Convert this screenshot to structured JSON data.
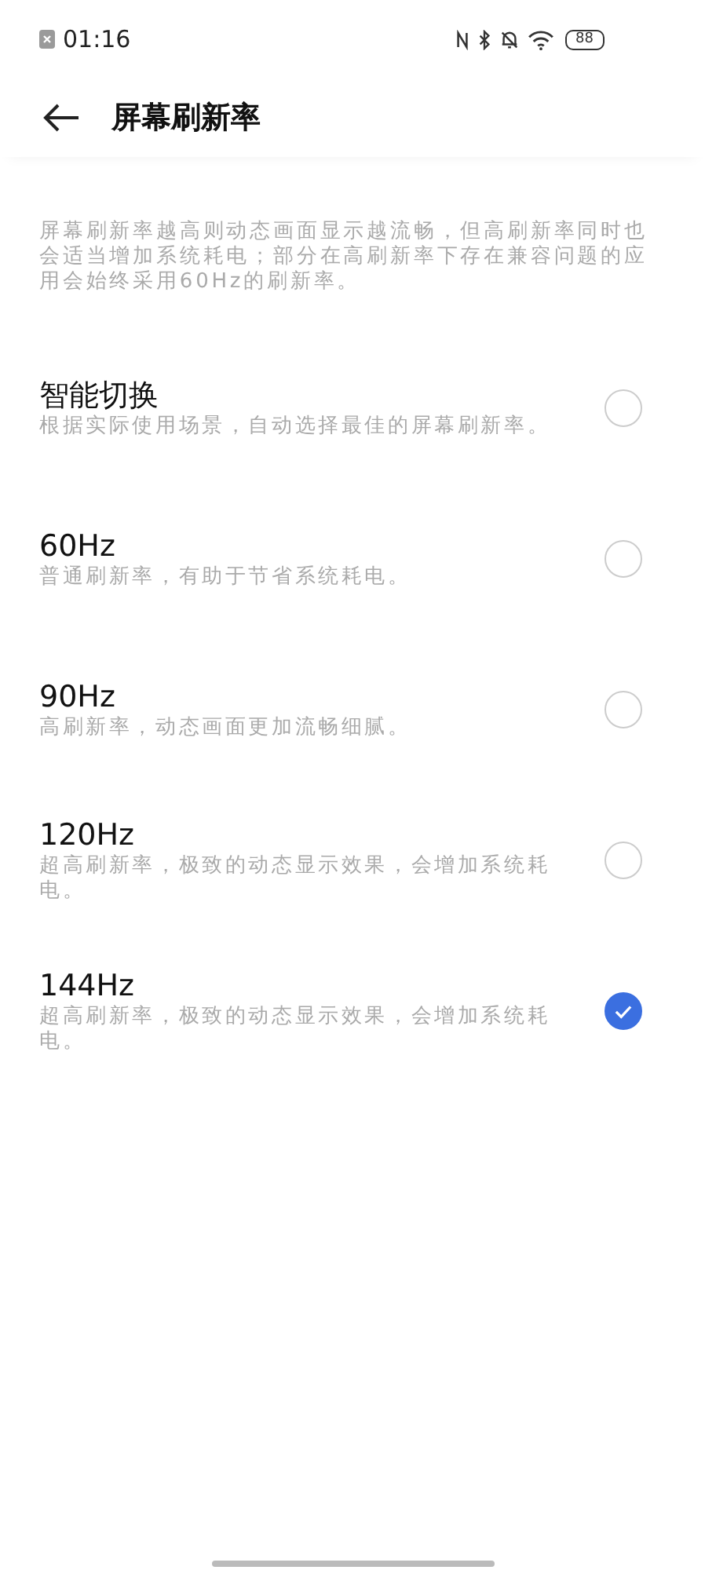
{
  "status_bar": {
    "time": "01:16",
    "battery": "88"
  },
  "header": {
    "title": "屏幕刷新率"
  },
  "intro": "屏幕刷新率越高则动态画面显示越流畅，但高刷新率同时也会适当增加系统耗电；部分在高刷新率下存在兼容问题的应用会始终采用60Hz的刷新率。",
  "options": [
    {
      "title": "智能切换",
      "description": "根据实际使用场景，自动选择最佳的屏幕刷新率。",
      "selected": false
    },
    {
      "title": "60Hz",
      "description": "普通刷新率，有助于节省系统耗电。",
      "selected": false
    },
    {
      "title": "90Hz",
      "description": "高刷新率，动态画面更加流畅细腻。",
      "selected": false
    },
    {
      "title": "120Hz",
      "description": "超高刷新率，极致的动态显示效果，会增加系统耗电。",
      "selected": false
    },
    {
      "title": "144Hz",
      "description": "超高刷新率，极致的动态显示效果，会增加系统耗电。",
      "selected": true
    }
  ]
}
